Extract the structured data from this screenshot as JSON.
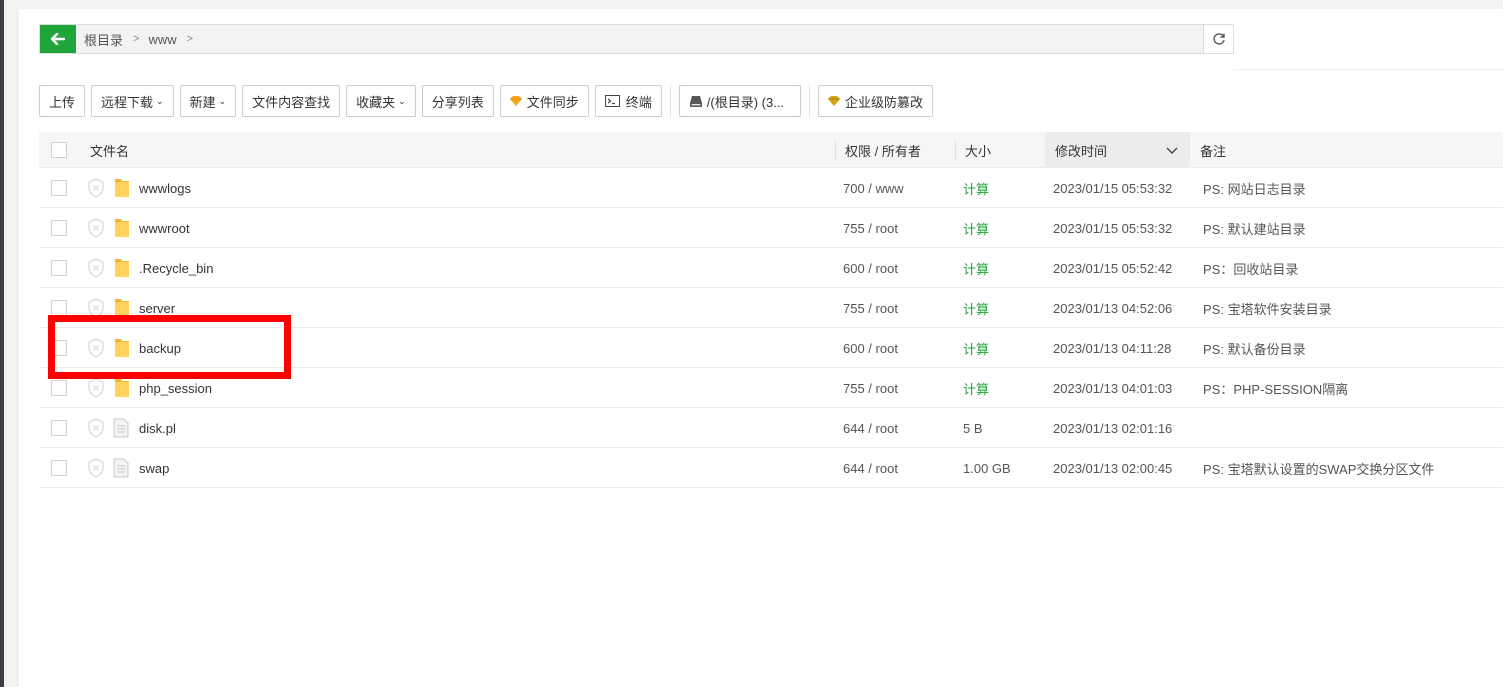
{
  "breadcrumb": {
    "root": "根目录",
    "dir": "www"
  },
  "toolbar": {
    "upload": "上传",
    "remote_download": "远程下载",
    "new": "新建",
    "content_search": "文件内容查找",
    "favorites": "收藏夹",
    "share_list": "分享列表",
    "file_sync": "文件同步",
    "terminal": "终端",
    "disk": "/(根目录) (3...",
    "tamper_proof": "企业级防篡改"
  },
  "columns": {
    "name": "文件名",
    "perm": "权限 / 所有者",
    "size": "大小",
    "mtime": "修改时间",
    "note": "备注"
  },
  "rows": [
    {
      "name": "wwwlogs",
      "type": "folder",
      "perm": "700 / www",
      "size": "计算",
      "mtime": "2023/01/15 05:53:32",
      "note": "PS: 网站日志目录"
    },
    {
      "name": "wwwroot",
      "type": "folder",
      "perm": "755 / root",
      "size": "计算",
      "mtime": "2023/01/15 05:53:32",
      "note": "PS: 默认建站目录"
    },
    {
      "name": ".Recycle_bin",
      "type": "folder",
      "perm": "600 / root",
      "size": "计算",
      "mtime": "2023/01/15 05:52:42",
      "note": "PS：回收站目录"
    },
    {
      "name": "server",
      "type": "folder",
      "perm": "755 / root",
      "size": "计算",
      "mtime": "2023/01/13 04:52:06",
      "note": "PS: 宝塔软件安装目录"
    },
    {
      "name": "backup",
      "type": "folder",
      "perm": "600 / root",
      "size": "计算",
      "mtime": "2023/01/13 04:11:28",
      "note": "PS: 默认备份目录"
    },
    {
      "name": "php_session",
      "type": "folder",
      "perm": "755 / root",
      "size": "计算",
      "mtime": "2023/01/13 04:01:03",
      "note": "PS：PHP-SESSION隔离"
    },
    {
      "name": "disk.pl",
      "type": "file",
      "perm": "644 / root",
      "size": "5 B",
      "mtime": "2023/01/13 02:01:16",
      "note": ""
    },
    {
      "name": "swap",
      "type": "file",
      "perm": "644 / root",
      "size": "1.00 GB",
      "mtime": "2023/01/13 02:00:45",
      "note": "PS: 宝塔默认设置的SWAP交换分区文件"
    }
  ]
}
